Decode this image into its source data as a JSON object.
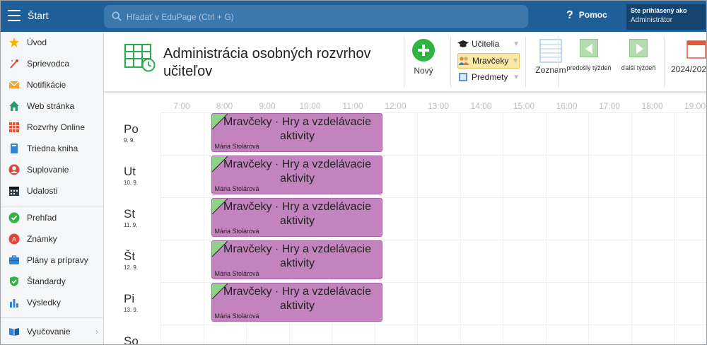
{
  "topbar": {
    "start_label": "Štart",
    "search_placeholder": "Hľadať v EduPage (Ctrl + G)",
    "help_label": "Pomoc",
    "user_line1": "Ste prihlásený ako",
    "user_line2": "Administrátor"
  },
  "sidebar": {
    "items": [
      {
        "label": "Úvod",
        "icon": "star-icon"
      },
      {
        "label": "Sprievodca",
        "icon": "wand-icon"
      },
      {
        "label": "Notifikácie",
        "icon": "envelope-icon"
      },
      {
        "label": "Web stránka",
        "icon": "house-icon"
      },
      {
        "label": "Rozvrhy Online",
        "icon": "timetable-icon"
      },
      {
        "label": "Triedna kniha",
        "icon": "book-icon"
      },
      {
        "label": "Suplovanie",
        "icon": "person-icon"
      },
      {
        "label": "Udalosti",
        "icon": "calendar-icon"
      },
      {
        "label": "Prehľad",
        "icon": "check-circle-icon"
      },
      {
        "label": "Známky",
        "icon": "grade-icon"
      },
      {
        "label": "Plány a prípravy",
        "icon": "briefcase-icon"
      },
      {
        "label": "Štandardy",
        "icon": "shield-icon"
      },
      {
        "label": "Výsledky",
        "icon": "bar-chart-icon"
      },
      {
        "label": "Vyučovanie",
        "icon": "open-book-icon"
      }
    ]
  },
  "toolbar": {
    "title": "Administrácia osobných rozvrhov učiteľov",
    "new_label": "Nový",
    "filters": [
      {
        "label": "Učitelia",
        "icon": "graduation-cap-icon"
      },
      {
        "label": "Mravčeky",
        "icon": "group-icon"
      },
      {
        "label": "Predmety",
        "icon": "subject-icon"
      }
    ],
    "list_label": "Zoznam",
    "prev_week": "predošlý týždeň",
    "next_week": "ďalší týždeň",
    "year": "2024/202"
  },
  "timetable": {
    "hours": [
      "7:00",
      "8:00",
      "9:00",
      "10:00",
      "11:00",
      "12:00",
      "13:00",
      "14:00",
      "15:00",
      "16:00",
      "17:00",
      "18:00",
      "19:00"
    ],
    "days": [
      {
        "name": "Po",
        "date": "9. 9."
      },
      {
        "name": "Ut",
        "date": "10. 9."
      },
      {
        "name": "St",
        "date": "11. 9."
      },
      {
        "name": "Št",
        "date": "12. 9."
      },
      {
        "name": "Pi",
        "date": "13. 9."
      },
      {
        "name": "So",
        "date": ""
      }
    ],
    "lessons": [
      {
        "title": "Mravčeky · Hry a vzdelávacie aktivity",
        "teacher": "Mária Stolárová",
        "start": "8:00",
        "end": "12:00"
      },
      {
        "title": "Mravčeky · Hry a vzdelávacie aktivity",
        "teacher": "Mária Stolárová",
        "start": "8:00",
        "end": "12:00"
      },
      {
        "title": "Mravčeky · Hry a vzdelávacie aktivity",
        "teacher": "Mária Stolárová",
        "start": "8:00",
        "end": "12:00"
      },
      {
        "title": "Mravčeky · Hry a vzdelávacie aktivity",
        "teacher": "Mária Stolárová",
        "start": "8:00",
        "end": "12:00"
      },
      {
        "title": "Mravčeky · Hry a vzdelávacie aktivity",
        "teacher": "Mária Stolárová",
        "start": "8:00",
        "end": "12:00"
      }
    ]
  },
  "colors": {
    "topbar": "#1e5f99",
    "lesson": "#c283bf",
    "new_button": "#2fb344"
  }
}
